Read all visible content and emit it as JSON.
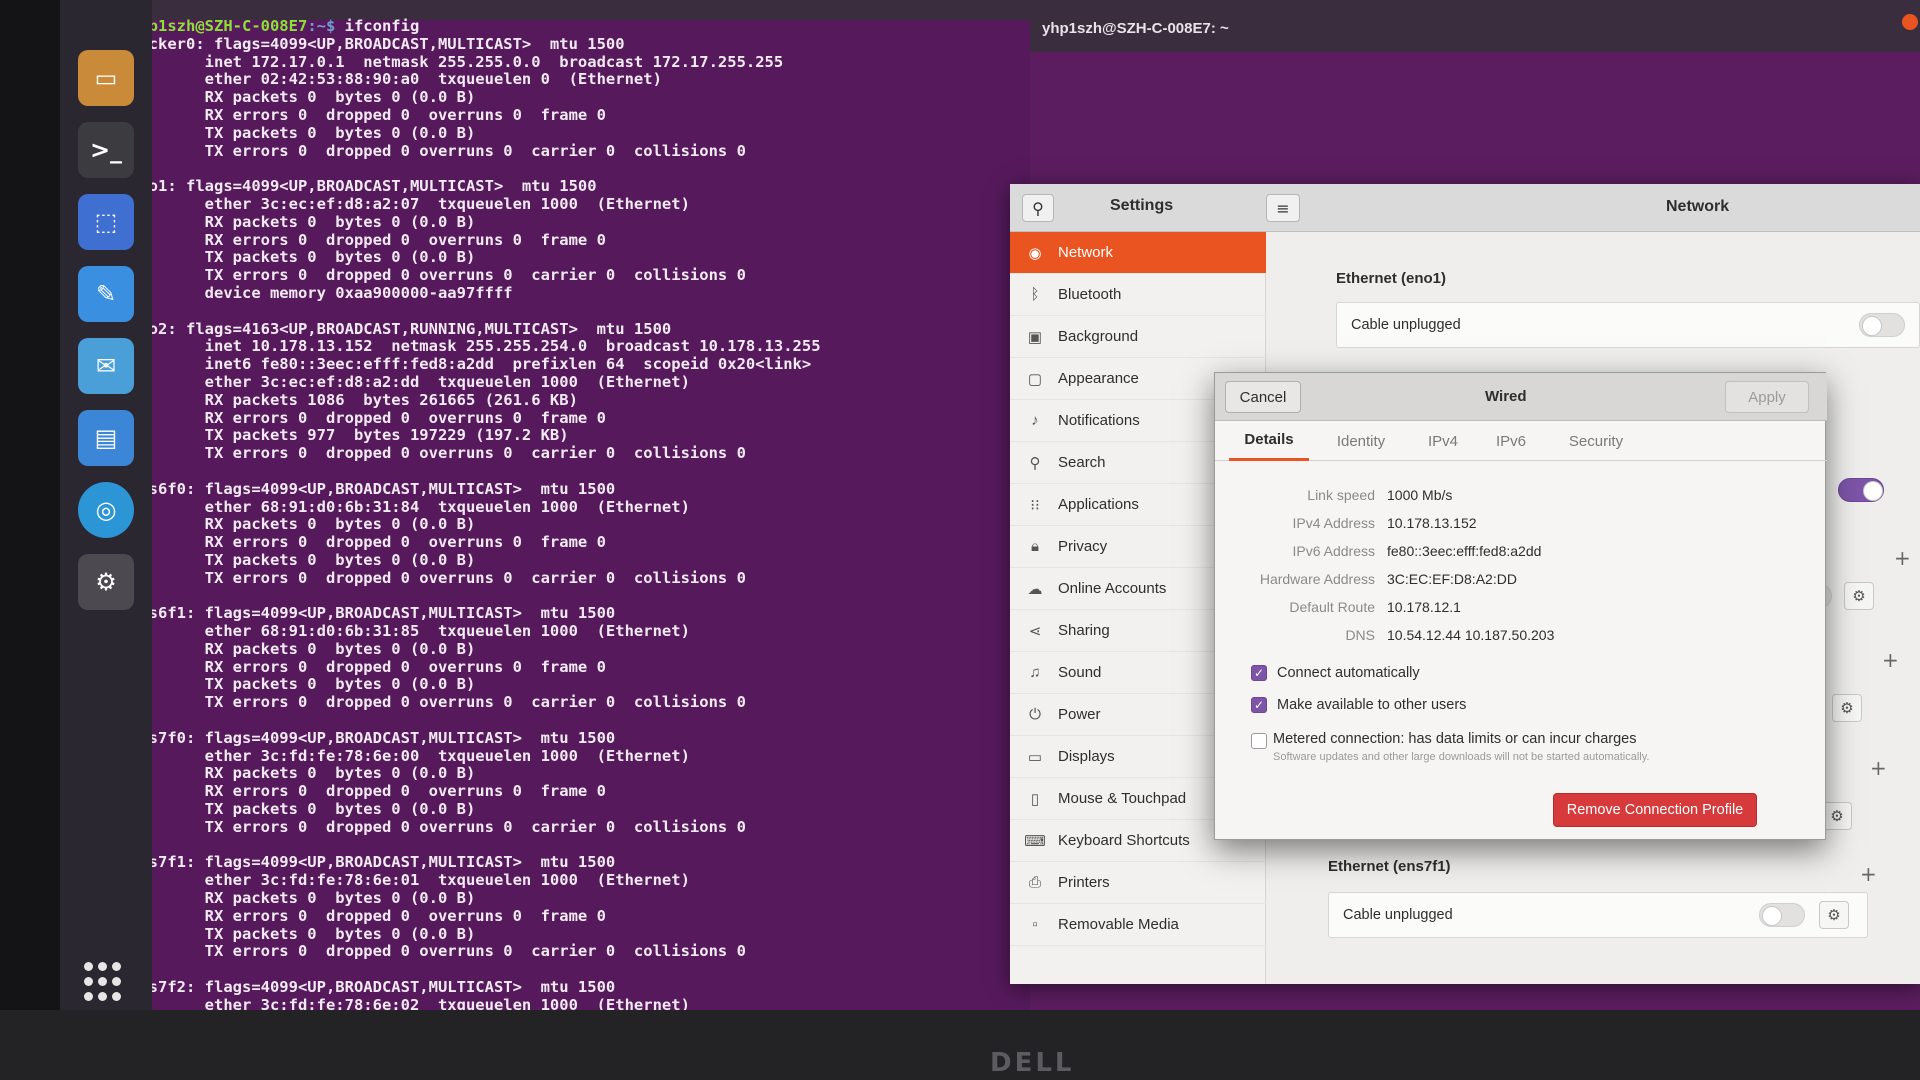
{
  "terminal": {
    "title": "yhp1szh@SZH-C-008E7: ~",
    "prompt_user": "yhp1szh@SZH-C-008E7",
    "prompt_path": ":~$",
    "command": " ifconfig",
    "output": "docker0: flags=4099<UP,BROADCAST,MULTICAST>  mtu 1500\n        inet 172.17.0.1  netmask 255.255.0.0  broadcast 172.17.255.255\n        ether 02:42:53:88:90:a0  txqueuelen 0  (Ethernet)\n        RX packets 0  bytes 0 (0.0 B)\n        RX errors 0  dropped 0  overruns 0  frame 0\n        TX packets 0  bytes 0 (0.0 B)\n        TX errors 0  dropped 0 overruns 0  carrier 0  collisions 0\n\neno1: flags=4099<UP,BROADCAST,MULTICAST>  mtu 1500\n        ether 3c:ec:ef:d8:a2:07  txqueuelen 1000  (Ethernet)\n        RX packets 0  bytes 0 (0.0 B)\n        RX errors 0  dropped 0  overruns 0  frame 0\n        TX packets 0  bytes 0 (0.0 B)\n        TX errors 0  dropped 0 overruns 0  carrier 0  collisions 0\n        device memory 0xaa900000-aa97ffff\n\neno2: flags=4163<UP,BROADCAST,RUNNING,MULTICAST>  mtu 1500\n        inet 10.178.13.152  netmask 255.255.254.0  broadcast 10.178.13.255\n        inet6 fe80::3eec:efff:fed8:a2dd  prefixlen 64  scopeid 0x20<link>\n        ether 3c:ec:ef:d8:a2:dd  txqueuelen 1000  (Ethernet)\n        RX packets 1086  bytes 261665 (261.6 KB)\n        RX errors 0  dropped 0  overruns 0  frame 0\n        TX packets 977  bytes 197229 (197.2 KB)\n        TX errors 0  dropped 0 overruns 0  carrier 0  collisions 0\n\nens6f0: flags=4099<UP,BROADCAST,MULTICAST>  mtu 1500\n        ether 68:91:d0:6b:31:84  txqueuelen 1000  (Ethernet)\n        RX packets 0  bytes 0 (0.0 B)\n        RX errors 0  dropped 0  overruns 0  frame 0\n        TX packets 0  bytes 0 (0.0 B)\n        TX errors 0  dropped 0 overruns 0  carrier 0  collisions 0\n\nens6f1: flags=4099<UP,BROADCAST,MULTICAST>  mtu 1500\n        ether 68:91:d0:6b:31:85  txqueuelen 1000  (Ethernet)\n        RX packets 0  bytes 0 (0.0 B)\n        RX errors 0  dropped 0  overruns 0  frame 0\n        TX packets 0  bytes 0 (0.0 B)\n        TX errors 0  dropped 0 overruns 0  carrier 0  collisions 0\n\nens7f0: flags=4099<UP,BROADCAST,MULTICAST>  mtu 1500\n        ether 3c:fd:fe:78:6e:00  txqueuelen 1000  (Ethernet)\n        RX packets 0  bytes 0 (0.0 B)\n        RX errors 0  dropped 0  overruns 0  frame 0\n        TX packets 0  bytes 0 (0.0 B)\n        TX errors 0  dropped 0 overruns 0  carrier 0  collisions 0\n\nens7f1: flags=4099<UP,BROADCAST,MULTICAST>  mtu 1500\n        ether 3c:fd:fe:78:6e:01  txqueuelen 1000  (Ethernet)\n        RX packets 0  bytes 0 (0.0 B)\n        RX errors 0  dropped 0  overruns 0  frame 0\n        TX packets 0  bytes 0 (0.0 B)\n        TX errors 0  dropped 0 overruns 0  carrier 0  collisions 0\n\nens7f2: flags=4099<UP,BROADCAST,MULTICAST>  mtu 1500\n        ether 3c:fd:fe:78:6e:02  txqueuelen 1000  (Ethernet)"
  },
  "dock": {
    "items": [
      {
        "name": "files",
        "icon": "folder-icon"
      },
      {
        "name": "terminal",
        "icon": "terminal-icon"
      },
      {
        "name": "screenshot",
        "icon": "screenshot-icon"
      },
      {
        "name": "text-editor",
        "icon": "pencil-icon"
      },
      {
        "name": "messages",
        "icon": "message-icon"
      },
      {
        "name": "document-viewer",
        "icon": "document-icon"
      },
      {
        "name": "remote",
        "icon": "remote-icon"
      },
      {
        "name": "settings",
        "icon": "gear-icon"
      }
    ]
  },
  "settings": {
    "title": "Settings",
    "panel_title": "Network",
    "sidebar": [
      {
        "label": "Network",
        "icon": "network-icon",
        "active": true
      },
      {
        "label": "Bluetooth",
        "icon": "bluetooth-icon"
      },
      {
        "label": "Background",
        "icon": "background-icon"
      },
      {
        "label": "Appearance",
        "icon": "appearance-icon"
      },
      {
        "label": "Notifications",
        "icon": "bell-icon"
      },
      {
        "label": "Search",
        "icon": "search-icon"
      },
      {
        "label": "Applications",
        "icon": "grid-icon"
      },
      {
        "label": "Privacy",
        "icon": "lock-icon"
      },
      {
        "label": "Online Accounts",
        "icon": "cloud-icon"
      },
      {
        "label": "Sharing",
        "icon": "share-icon"
      },
      {
        "label": "Sound",
        "icon": "music-icon"
      },
      {
        "label": "Power",
        "icon": "power-icon"
      },
      {
        "label": "Displays",
        "icon": "display-icon"
      },
      {
        "label": "Mouse & Touchpad",
        "icon": "mouse-icon"
      },
      {
        "label": "Keyboard Shortcuts",
        "icon": "keyboard-icon"
      },
      {
        "label": "Printers",
        "icon": "printer-icon"
      },
      {
        "label": "Removable Media",
        "icon": "media-icon"
      }
    ],
    "network": {
      "eno1_title": "Ethernet (eno1)",
      "eno1_status": "Cable unplugged",
      "ens7f1_title": "Ethernet (ens7f1)",
      "ens7f1_status": "Cable unplugged"
    }
  },
  "wired_dialog": {
    "title": "Wired",
    "cancel": "Cancel",
    "apply": "Apply",
    "tabs": [
      "Details",
      "Identity",
      "IPv4",
      "IPv6",
      "Security"
    ],
    "details": [
      {
        "label": "Link speed",
        "value": "1000 Mb/s"
      },
      {
        "label": "IPv4 Address",
        "value": "10.178.13.152"
      },
      {
        "label": "IPv6 Address",
        "value": "fe80::3eec:efff:fed8:a2dd"
      },
      {
        "label": "Hardware Address",
        "value": "3C:EC:EF:D8:A2:DD"
      },
      {
        "label": "Default Route",
        "value": "10.178.12.1"
      },
      {
        "label": "DNS",
        "value": "10.54.12.44 10.187.50.203"
      }
    ],
    "connect_automatically": "Connect automatically",
    "make_available": "Make available to other users",
    "metered": "Metered connection: has data limits or can incur charges",
    "metered_note": "Software updates and other large downloads will not be started automatically.",
    "remove": "Remove Connection Profile"
  },
  "brand": "DELL",
  "colors": {
    "accent": "#e95420",
    "terminal_bg": "#561a5c",
    "danger": "#d63a3a",
    "toggle_on": "#7d54a8"
  }
}
